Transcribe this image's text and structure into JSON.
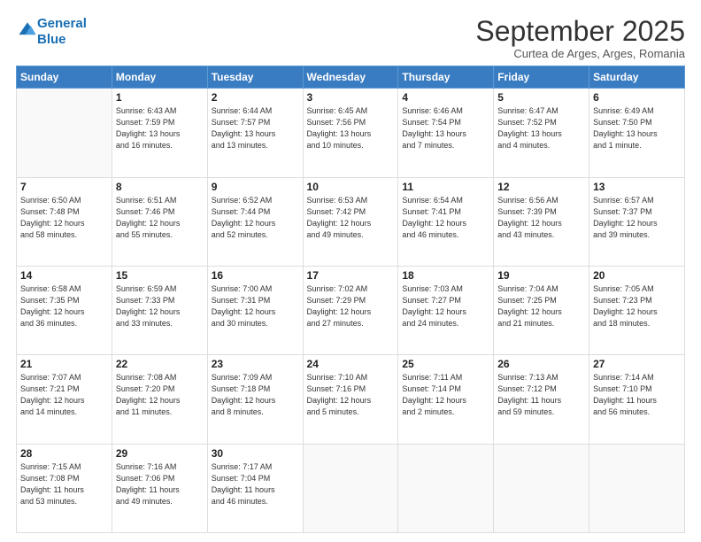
{
  "header": {
    "logo_line1": "General",
    "logo_line2": "Blue",
    "title": "September 2025",
    "subtitle": "Curtea de Arges, Arges, Romania"
  },
  "weekdays": [
    "Sunday",
    "Monday",
    "Tuesday",
    "Wednesday",
    "Thursday",
    "Friday",
    "Saturday"
  ],
  "weeks": [
    [
      {
        "day": "",
        "info": ""
      },
      {
        "day": "1",
        "info": "Sunrise: 6:43 AM\nSunset: 7:59 PM\nDaylight: 13 hours\nand 16 minutes."
      },
      {
        "day": "2",
        "info": "Sunrise: 6:44 AM\nSunset: 7:57 PM\nDaylight: 13 hours\nand 13 minutes."
      },
      {
        "day": "3",
        "info": "Sunrise: 6:45 AM\nSunset: 7:56 PM\nDaylight: 13 hours\nand 10 minutes."
      },
      {
        "day": "4",
        "info": "Sunrise: 6:46 AM\nSunset: 7:54 PM\nDaylight: 13 hours\nand 7 minutes."
      },
      {
        "day": "5",
        "info": "Sunrise: 6:47 AM\nSunset: 7:52 PM\nDaylight: 13 hours\nand 4 minutes."
      },
      {
        "day": "6",
        "info": "Sunrise: 6:49 AM\nSunset: 7:50 PM\nDaylight: 13 hours\nand 1 minute."
      }
    ],
    [
      {
        "day": "7",
        "info": "Sunrise: 6:50 AM\nSunset: 7:48 PM\nDaylight: 12 hours\nand 58 minutes."
      },
      {
        "day": "8",
        "info": "Sunrise: 6:51 AM\nSunset: 7:46 PM\nDaylight: 12 hours\nand 55 minutes."
      },
      {
        "day": "9",
        "info": "Sunrise: 6:52 AM\nSunset: 7:44 PM\nDaylight: 12 hours\nand 52 minutes."
      },
      {
        "day": "10",
        "info": "Sunrise: 6:53 AM\nSunset: 7:42 PM\nDaylight: 12 hours\nand 49 minutes."
      },
      {
        "day": "11",
        "info": "Sunrise: 6:54 AM\nSunset: 7:41 PM\nDaylight: 12 hours\nand 46 minutes."
      },
      {
        "day": "12",
        "info": "Sunrise: 6:56 AM\nSunset: 7:39 PM\nDaylight: 12 hours\nand 43 minutes."
      },
      {
        "day": "13",
        "info": "Sunrise: 6:57 AM\nSunset: 7:37 PM\nDaylight: 12 hours\nand 39 minutes."
      }
    ],
    [
      {
        "day": "14",
        "info": "Sunrise: 6:58 AM\nSunset: 7:35 PM\nDaylight: 12 hours\nand 36 minutes."
      },
      {
        "day": "15",
        "info": "Sunrise: 6:59 AM\nSunset: 7:33 PM\nDaylight: 12 hours\nand 33 minutes."
      },
      {
        "day": "16",
        "info": "Sunrise: 7:00 AM\nSunset: 7:31 PM\nDaylight: 12 hours\nand 30 minutes."
      },
      {
        "day": "17",
        "info": "Sunrise: 7:02 AM\nSunset: 7:29 PM\nDaylight: 12 hours\nand 27 minutes."
      },
      {
        "day": "18",
        "info": "Sunrise: 7:03 AM\nSunset: 7:27 PM\nDaylight: 12 hours\nand 24 minutes."
      },
      {
        "day": "19",
        "info": "Sunrise: 7:04 AM\nSunset: 7:25 PM\nDaylight: 12 hours\nand 21 minutes."
      },
      {
        "day": "20",
        "info": "Sunrise: 7:05 AM\nSunset: 7:23 PM\nDaylight: 12 hours\nand 18 minutes."
      }
    ],
    [
      {
        "day": "21",
        "info": "Sunrise: 7:07 AM\nSunset: 7:21 PM\nDaylight: 12 hours\nand 14 minutes."
      },
      {
        "day": "22",
        "info": "Sunrise: 7:08 AM\nSunset: 7:20 PM\nDaylight: 12 hours\nand 11 minutes."
      },
      {
        "day": "23",
        "info": "Sunrise: 7:09 AM\nSunset: 7:18 PM\nDaylight: 12 hours\nand 8 minutes."
      },
      {
        "day": "24",
        "info": "Sunrise: 7:10 AM\nSunset: 7:16 PM\nDaylight: 12 hours\nand 5 minutes."
      },
      {
        "day": "25",
        "info": "Sunrise: 7:11 AM\nSunset: 7:14 PM\nDaylight: 12 hours\nand 2 minutes."
      },
      {
        "day": "26",
        "info": "Sunrise: 7:13 AM\nSunset: 7:12 PM\nDaylight: 11 hours\nand 59 minutes."
      },
      {
        "day": "27",
        "info": "Sunrise: 7:14 AM\nSunset: 7:10 PM\nDaylight: 11 hours\nand 56 minutes."
      }
    ],
    [
      {
        "day": "28",
        "info": "Sunrise: 7:15 AM\nSunset: 7:08 PM\nDaylight: 11 hours\nand 53 minutes."
      },
      {
        "day": "29",
        "info": "Sunrise: 7:16 AM\nSunset: 7:06 PM\nDaylight: 11 hours\nand 49 minutes."
      },
      {
        "day": "30",
        "info": "Sunrise: 7:17 AM\nSunset: 7:04 PM\nDaylight: 11 hours\nand 46 minutes."
      },
      {
        "day": "",
        "info": ""
      },
      {
        "day": "",
        "info": ""
      },
      {
        "day": "",
        "info": ""
      },
      {
        "day": "",
        "info": ""
      }
    ]
  ]
}
